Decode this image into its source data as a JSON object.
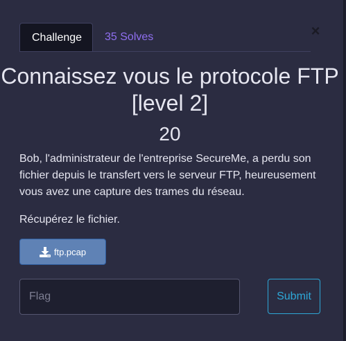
{
  "modal": {
    "close_symbol": "×",
    "close_icon": "close-icon"
  },
  "tabs": [
    {
      "label": "Challenge",
      "active": true
    },
    {
      "label": "35 Solves",
      "active": false
    }
  ],
  "challenge": {
    "title": "Connaissez vous le protocole FTP [level 2]",
    "points": "20",
    "description": "Bob, l'administrateur de l'entreprise SecureMe, a perdu son fichier depuis le transfert vers le serveur FTP, heureusement vous avez une capture des trames du réseau.",
    "task": "Récupérez le fichier.",
    "file": {
      "name": "ftp.pcap",
      "icon": "download-icon"
    }
  },
  "form": {
    "flag_placeholder": "Flag",
    "flag_value": "",
    "submit_label": "Submit"
  },
  "colors": {
    "modal_background": "#2b2c41",
    "tab_accent": "#8f6ff0",
    "file_button": "#5f82b5",
    "submit_accent": "#2ea8d8"
  }
}
